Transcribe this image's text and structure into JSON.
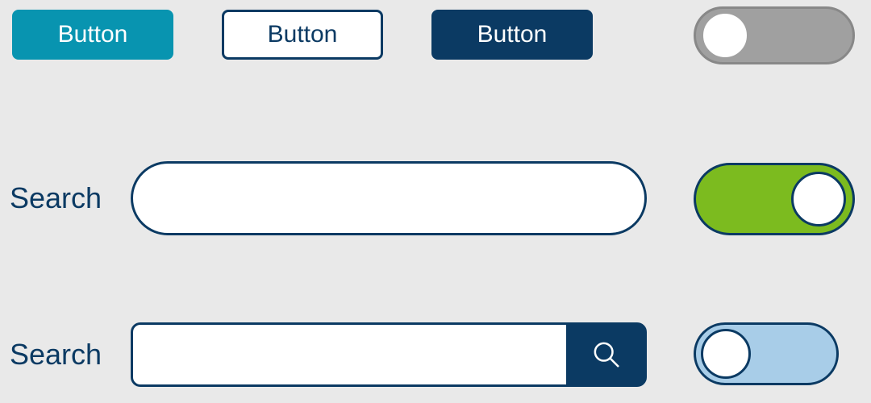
{
  "buttons": {
    "teal": {
      "label": "Button"
    },
    "outline": {
      "label": "Button"
    },
    "navy": {
      "label": "Button"
    }
  },
  "toggles": {
    "grey": {
      "state": "off",
      "track": "#a0a0a0",
      "knob": "#ffffff"
    },
    "green": {
      "state": "on",
      "track": "#7cbb1f",
      "knob": "#ffffff"
    },
    "blue": {
      "state": "off",
      "track": "#a8cde8",
      "knob": "#ffffff"
    }
  },
  "search": {
    "pill": {
      "label": "Search",
      "value": "",
      "placeholder": ""
    },
    "rect": {
      "label": "Search",
      "value": "",
      "placeholder": ""
    },
    "submit_icon": "search-icon"
  },
  "colors": {
    "navy": "#0b3a63",
    "teal": "#0894b0",
    "green": "#7cbb1f",
    "lightblue": "#a8cde8",
    "grey": "#a0a0a0",
    "bg": "#e9e9e9"
  }
}
